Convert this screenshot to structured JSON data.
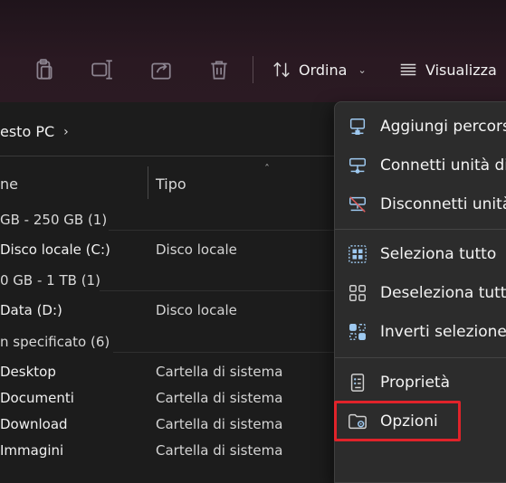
{
  "toolbar": {
    "sort_label": "Ordina",
    "view_label": "Visualizza"
  },
  "breadcrumb": {
    "location": "esto PC"
  },
  "columns": {
    "name": "ne",
    "type": "Tipo"
  },
  "groups": [
    {
      "label": "GB - 250 GB (1)"
    },
    {
      "label": "0 GB - 1 TB (1)"
    },
    {
      "label": "n specificato (6)"
    }
  ],
  "drives": [
    {
      "name": "Disco locale (C:)",
      "type": "Disco locale"
    },
    {
      "name": "Data (D:)",
      "type": "Disco locale"
    }
  ],
  "folders": [
    {
      "name": "Desktop",
      "type": "Cartella di sistema"
    },
    {
      "name": "Documenti",
      "type": "Cartella di sistema"
    },
    {
      "name": "Download",
      "type": "Cartella di sistema"
    },
    {
      "name": "Immagini",
      "type": "Cartella di sistema"
    }
  ],
  "menu": {
    "items": [
      {
        "label": "Aggiungi percors",
        "icon": "network-location-icon"
      },
      {
        "label": "Connetti unità di",
        "icon": "map-network-drive-icon"
      },
      {
        "label": "Disconnetti unità",
        "icon": "disconnect-drive-icon"
      },
      {
        "label": "Seleziona tutto",
        "icon": "select-all-icon"
      },
      {
        "label": "Deseleziona tutto",
        "icon": "select-none-icon"
      },
      {
        "label": "Inverti selezione",
        "icon": "invert-selection-icon"
      },
      {
        "label": "Proprietà",
        "icon": "properties-icon"
      },
      {
        "label": "Opzioni",
        "icon": "folder-options-icon"
      }
    ],
    "highlight_color": "#e0232a"
  }
}
